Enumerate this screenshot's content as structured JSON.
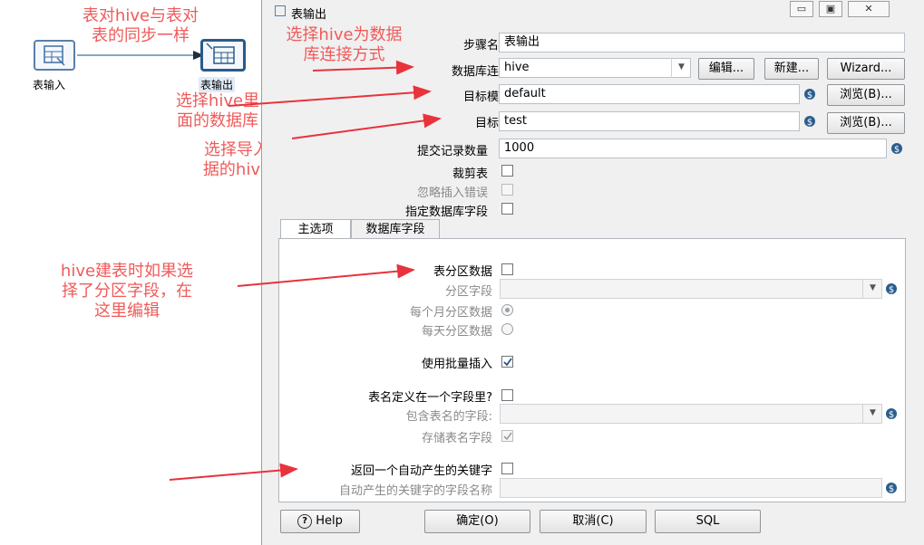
{
  "canvas": {
    "step_input_label": "表输入",
    "step_output_label": "表输出"
  },
  "annotations": {
    "sync": "表对hive与表对\n表的同步一样",
    "select_hive": "选择hive为数据\n库连接方式",
    "select_db": "选择hive里\n面的数据库",
    "select_table": "选择导入数\n据的hive表",
    "partition": "hive建表时如果选\n择了分区字段，在\n这里编辑"
  },
  "dialog": {
    "title": "表输出",
    "window_buttons": {
      "minimize": "▭",
      "maximize": "▣",
      "close": "✕"
    },
    "step_name_label": "步骤名称",
    "step_name_value": "表输出",
    "connection_label": "数据库连接",
    "connection_value": "hive",
    "edit_label": "编辑...",
    "new_label": "新建...",
    "wizard_label": "Wizard...",
    "schema_label": "目标模式",
    "schema_value": "default",
    "browse_label": "浏览(B)...",
    "table_label": "目标表",
    "table_value": "test",
    "commit_label": "提交记录数量",
    "commit_value": "1000",
    "truncate_label": "裁剪表",
    "ignore_errors_label": "忽略插入错误",
    "specify_fields_label": "指定数据库字段",
    "tabs": [
      "主选项",
      "数据库字段"
    ],
    "partition_label": "表分区数据",
    "partition_field_label": "分区字段",
    "monthly_label": "每个月分区数据",
    "daily_label": "每天分区数据",
    "batch_label": "使用批量插入",
    "batch_checked": true,
    "table_in_field_label": "表名定义在一个字段里?",
    "table_name_field_label": "包含表名的字段:",
    "store_table_name_label": "存储表名字段",
    "store_table_name_checked": true,
    "return_key_label": "返回一个自动产生的关键字",
    "auto_key_field_label": "自动产生的关键字的字段名称",
    "help_label": "Help",
    "ok_label": "确定(O)",
    "cancel_label": "取消(C)",
    "sql_label": "SQL"
  },
  "colors": {
    "annotation": "#f05a5a",
    "arrow": "#e8323c",
    "var_icon": "#2a5d8f"
  }
}
